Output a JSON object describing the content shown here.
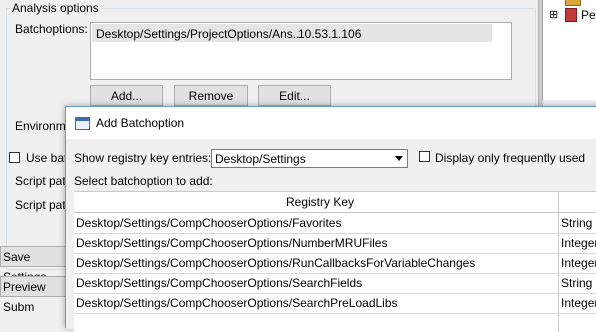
{
  "analysis": {
    "group_title": "Analysis options",
    "batchoptions_label": "Batchoptions:",
    "batch_entries": [
      {
        "path": "Desktop/Settings/ProjectOptions/Ans...",
        "value": "10.53.1.106"
      }
    ],
    "add_label": "Add...",
    "remove_label": "Remove",
    "edit_label": "Edit...",
    "environment_label": "Environme",
    "use_batch_label": "Use batc",
    "script_path_label_1": "Script path",
    "script_path_label_2": "Script path"
  },
  "left_buttons": {
    "save_settings_label": "Save Settings",
    "preview_submit_label": "Preview Subm"
  },
  "tree": {
    "expand_symbol": "⊞",
    "item_label": "Pe"
  },
  "dialog": {
    "title": "Add Batchoption",
    "show_registry_label": "Show registry key entries:",
    "combo_value": "Desktop/Settings",
    "frequent_label": "Display only frequently used",
    "select_label": "Select batchoption to add:",
    "columns": [
      "Registry Key",
      ""
    ],
    "rows": [
      {
        "key": "Desktop/Settings/CompChooserOptions/Favorites",
        "type": "String"
      },
      {
        "key": "Desktop/Settings/CompChooserOptions/NumberMRUFiles",
        "type": "Integer"
      },
      {
        "key": "Desktop/Settings/CompChooserOptions/RunCallbacksForVariableChanges",
        "type": "Integer"
      },
      {
        "key": "Desktop/Settings/CompChooserOptions/SearchFields",
        "type": "String"
      },
      {
        "key": "Desktop/Settings/CompChooserOptions/SearchPreLoadLibs",
        "type": "Integer"
      }
    ]
  }
}
